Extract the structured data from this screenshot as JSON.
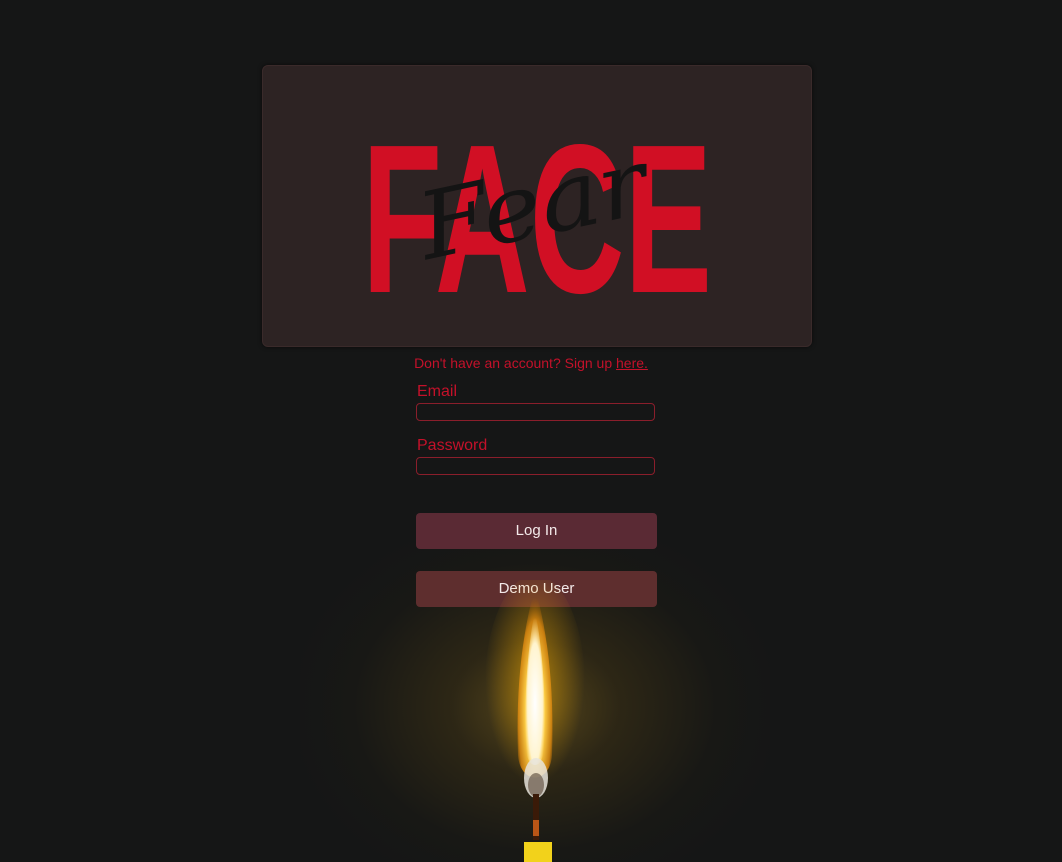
{
  "logo": {
    "main_word": "FACE",
    "script_word": "Fear",
    "brand_red": "#d10f24"
  },
  "signup": {
    "prompt": "Don't have an account? Sign up ",
    "link_text": "here."
  },
  "form": {
    "email_label": "Email",
    "email_value": "",
    "password_label": "Password",
    "password_value": ""
  },
  "buttons": {
    "login_label": "Log In",
    "demo_label": "Demo User"
  },
  "colors": {
    "background": "#151616",
    "accent_red": "#c4112a",
    "card": "#2d2323"
  }
}
